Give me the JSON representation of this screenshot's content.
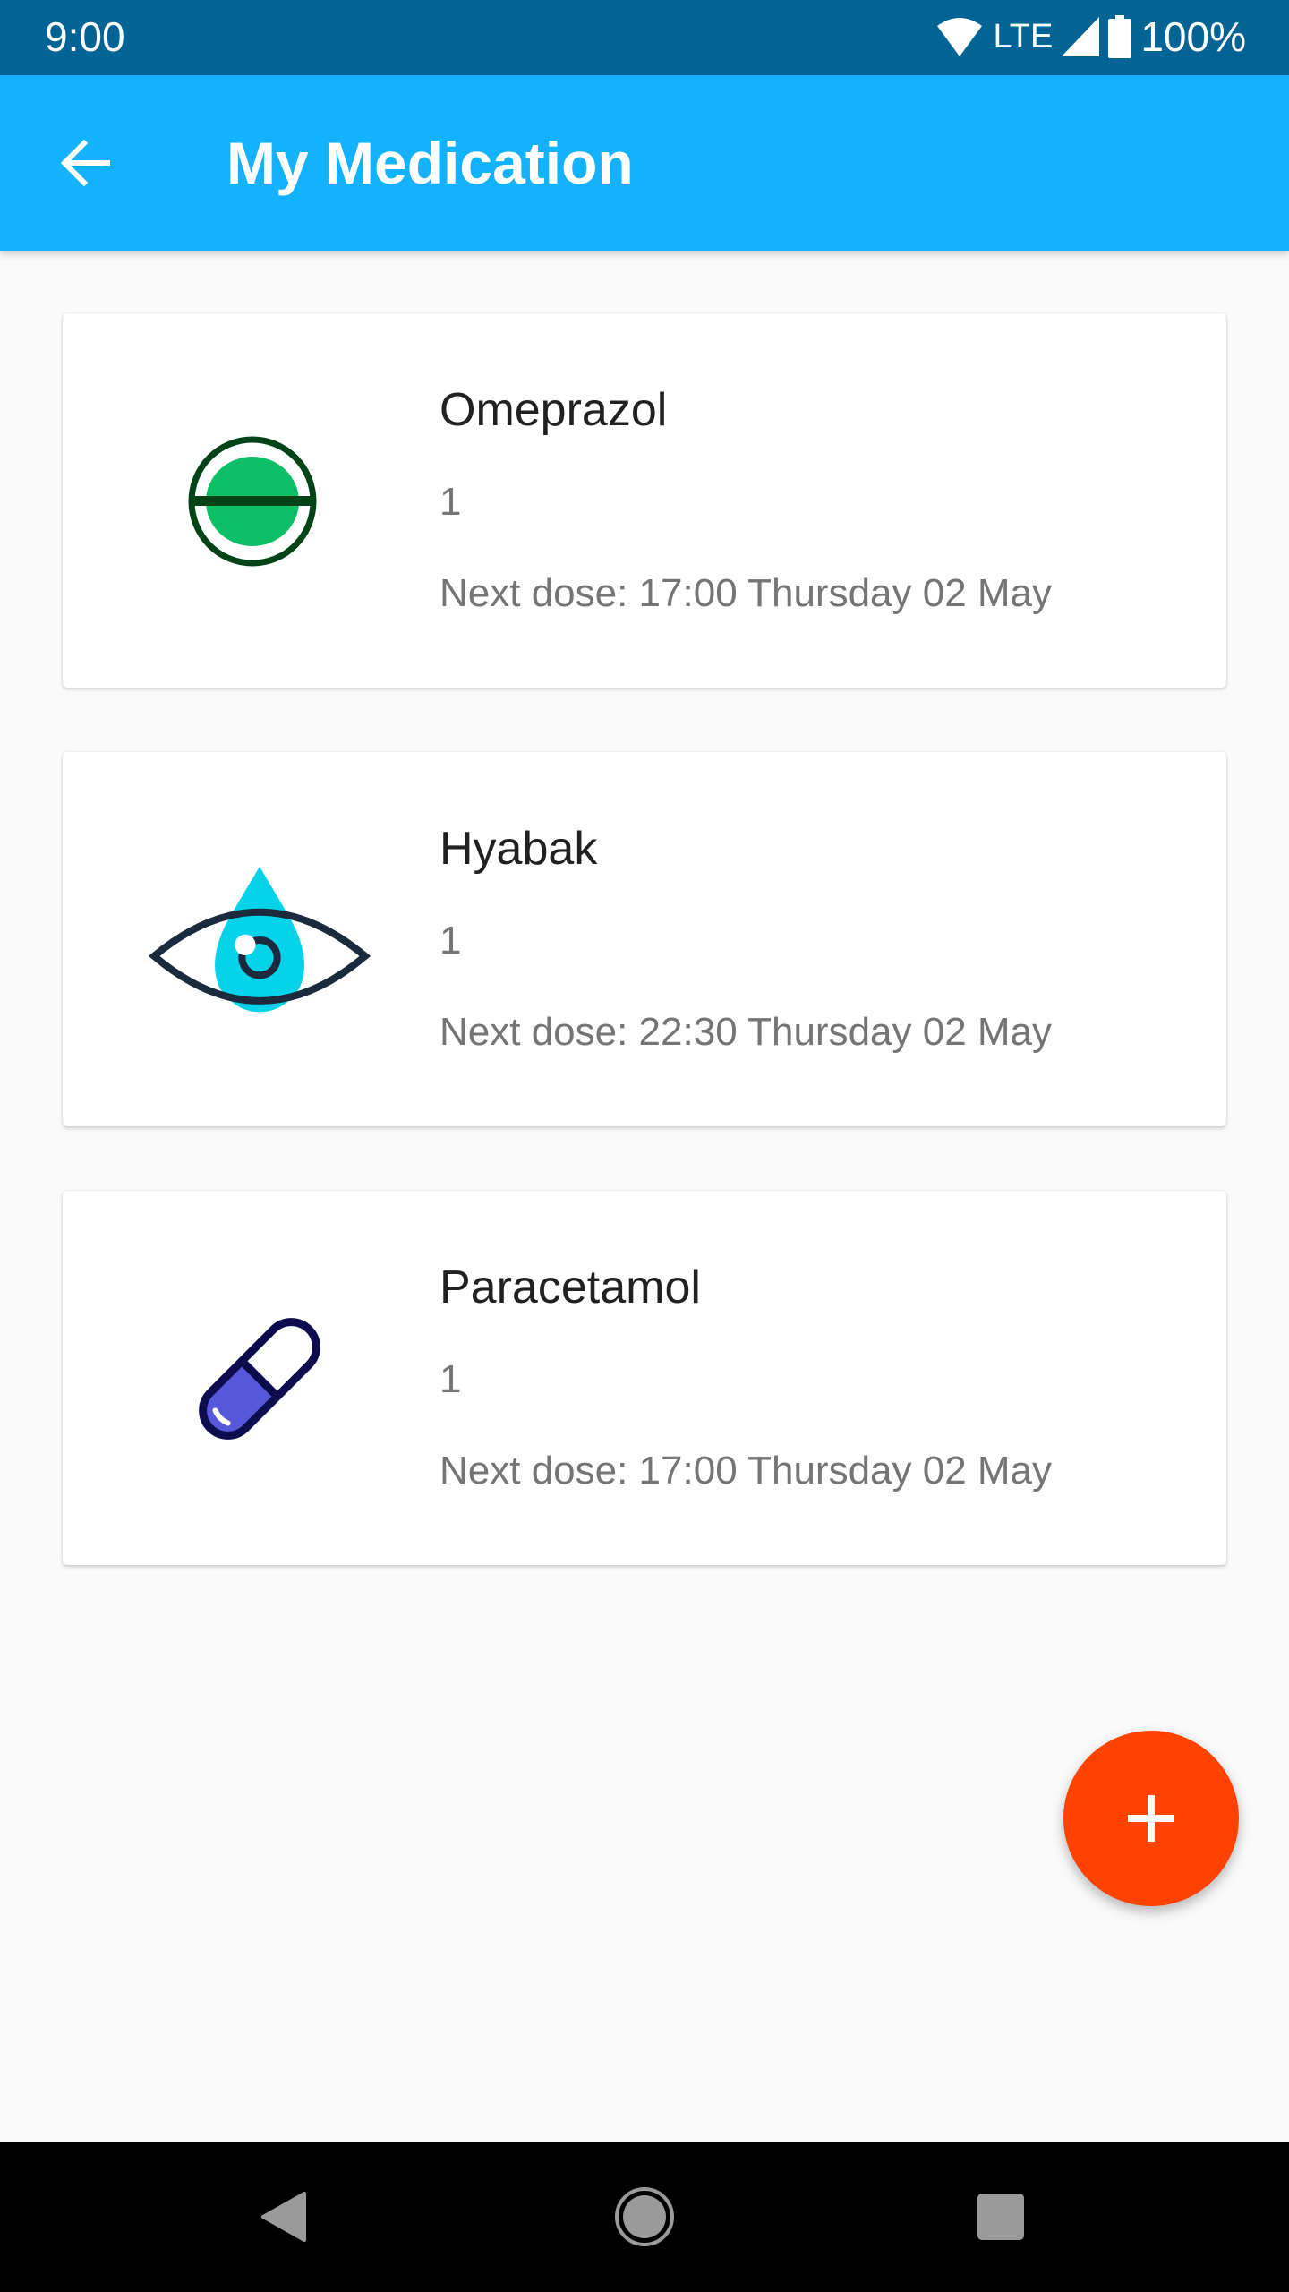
{
  "status_bar": {
    "time": "9:00",
    "network": "LTE",
    "battery": "100%",
    "icons": [
      "wifi-icon",
      "signal-icon",
      "battery-icon"
    ]
  },
  "app_bar": {
    "title": "My Medication",
    "back_icon": "arrow-back-icon",
    "color": "#14b2fd"
  },
  "medications": [
    {
      "name": "Omeprazol",
      "quantity": "1",
      "next_dose": "Next dose: 17:00 Thursday 02 May",
      "icon": "tablet-icon"
    },
    {
      "name": "Hyabak",
      "quantity": "1",
      "next_dose": "Next dose: 22:30 Thursday 02 May",
      "icon": "eye-drop-icon"
    },
    {
      "name": "Paracetamol",
      "quantity": "1",
      "next_dose": "Next dose: 17:00 Thursday 02 May",
      "icon": "capsule-icon"
    }
  ],
  "fab": {
    "icon": "plus-icon",
    "color": "#fe4200"
  },
  "nav_bar": {
    "buttons": [
      "nav-back-icon",
      "nav-home-icon",
      "nav-recents-icon"
    ]
  }
}
